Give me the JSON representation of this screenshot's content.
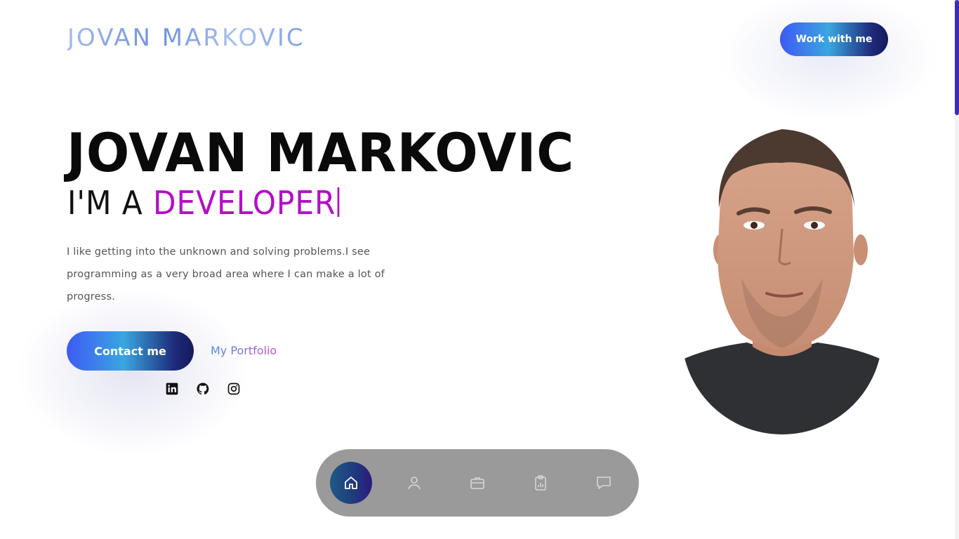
{
  "header": {
    "logo": "JOVAN MARKOVIC",
    "cta_label": "Work with me"
  },
  "hero": {
    "name": "JOVAN MARKOVIC",
    "role_prefix": "I'M A ",
    "role_word": "DEVELOPER",
    "description": "I like getting into the unknown and solving problems.I see programming as a very broad area where I can make a lot of progress.",
    "contact_label": "Contact me",
    "portfolio_label": "My Portfolio"
  },
  "socials": [
    {
      "icon": "linkedin-icon"
    },
    {
      "icon": "github-icon"
    },
    {
      "icon": "instagram-icon"
    }
  ],
  "bottom_nav": {
    "items": [
      {
        "icon": "home-icon",
        "active": true
      },
      {
        "icon": "user-icon",
        "active": false
      },
      {
        "icon": "briefcase-icon",
        "active": false
      },
      {
        "icon": "clipboard-chart-icon",
        "active": false
      },
      {
        "icon": "message-icon",
        "active": false
      }
    ]
  },
  "colors": {
    "accent_purple": "#b20fc7",
    "button_gradient_start": "#3d5af5",
    "button_gradient_end": "#151a5c",
    "nav_background": "#9a9a9a"
  }
}
